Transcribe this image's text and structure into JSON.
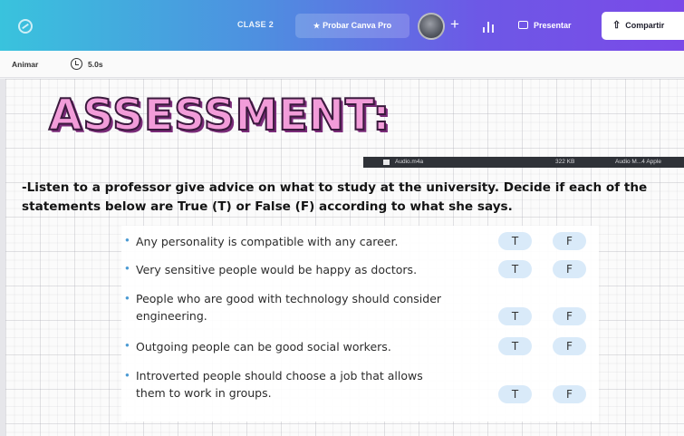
{
  "topbar": {
    "design_name": "CLASE 2",
    "probar_label": "Probar Canva Pro",
    "avatar_plus": "+",
    "present_label": "Presentar",
    "share_label": "Compartir",
    "colors": {
      "gradient_start": "#39c3dd",
      "gradient_end": "#7b4ae8"
    }
  },
  "animbar": {
    "animate_label": "Animar",
    "duration": "5.0s"
  },
  "slide": {
    "title": "ASSESSMENT:",
    "audio_file": {
      "name": "Audio.m4a",
      "size": "322 KB",
      "kind": "Audio M...4 Apple"
    },
    "instructions": "-Listen to a professor give advice on what to study at the university. Decide if each of the statements below are True (T) or False (F) according to what she says.",
    "statements": [
      {
        "text": "Any personality is compatible with any career.",
        "t": "T",
        "f": "F"
      },
      {
        "text": "Very sensitive people would be happy as doctors.",
        "t": "T",
        "f": "F"
      },
      {
        "text": "People who are good with technology should consider engineering.",
        "t": "T",
        "f": "F"
      },
      {
        "text": "Outgoing people can be good social workers.",
        "t": "T",
        "f": "F"
      },
      {
        "text": "Introverted people should choose a job that allows them to work in groups.",
        "t": "T",
        "f": "F"
      }
    ]
  }
}
